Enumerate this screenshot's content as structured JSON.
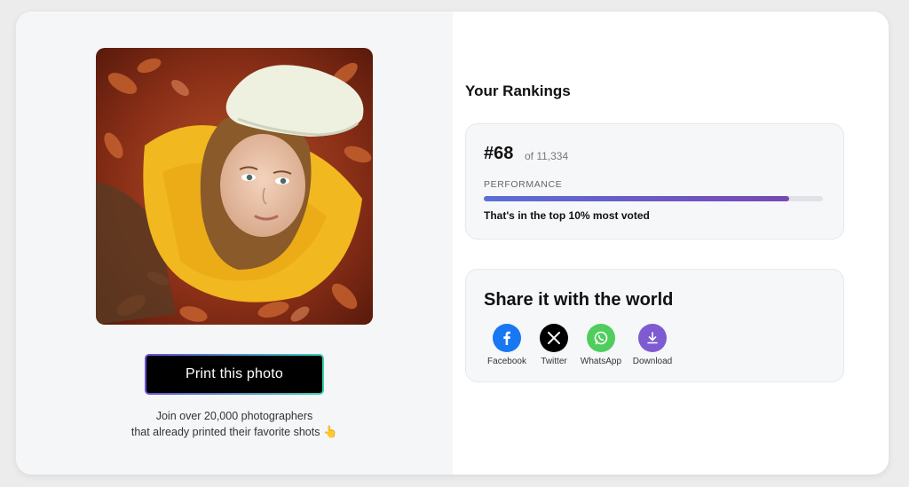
{
  "print_button": {
    "label": "Print this photo"
  },
  "join": {
    "line1": "Join over 20,000 photographers",
    "line2": "that already printed their favorite shots",
    "emoji": "👆"
  },
  "rankings": {
    "title": "Your Rankings",
    "rank": "#68",
    "of_total": "of 11,334",
    "performance_label": "PERFORMANCE",
    "performance_fraction": 0.9,
    "summary": "That's in the top 10% most voted"
  },
  "share": {
    "title": "Share it with the world",
    "items": [
      {
        "label": "Facebook",
        "icon": "facebook-icon",
        "color": "#1877f2"
      },
      {
        "label": "Twitter",
        "icon": "x-icon",
        "color": "#000000"
      },
      {
        "label": "WhatsApp",
        "icon": "whatsapp-icon",
        "color": "#4fce5d"
      },
      {
        "label": "Download",
        "icon": "download-icon",
        "color": "#7e5bd0"
      }
    ]
  }
}
